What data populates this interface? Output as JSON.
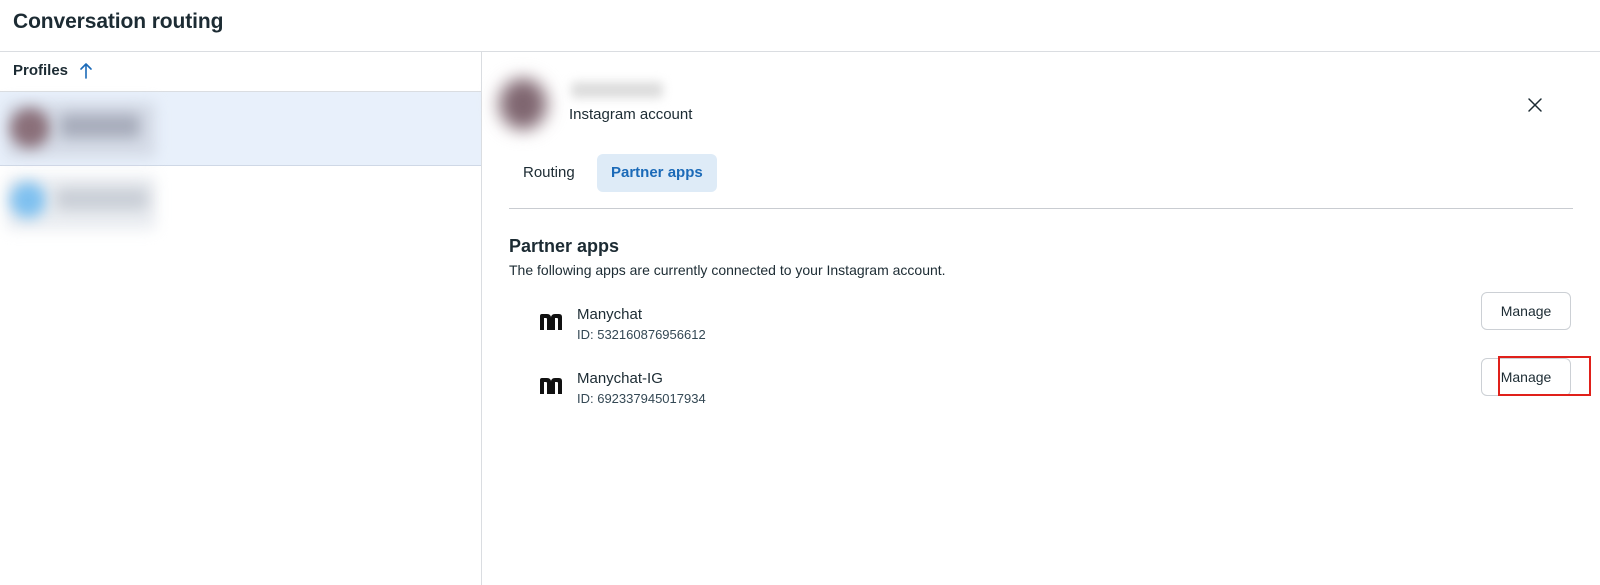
{
  "page": {
    "title": "Conversation routing"
  },
  "profiles": {
    "header_label": "Profiles",
    "sort_icon": "arrow-up-icon",
    "rows": [
      {
        "selected": true
      },
      {
        "selected": false
      }
    ]
  },
  "detail": {
    "account_type": "Instagram account",
    "close_icon": "close-icon",
    "tabs": [
      {
        "label": "Routing",
        "active": false
      },
      {
        "label": "Partner apps",
        "active": true
      }
    ],
    "section": {
      "title": "Partner apps",
      "description": "The following apps are currently connected to your Instagram account."
    },
    "apps": [
      {
        "name": "Manychat",
        "id": "ID: 532160876956612",
        "logo_icon": "manychat-logo-icon",
        "action_label": "Manage"
      },
      {
        "name": "Manychat-IG",
        "id": "ID: 692337945017934",
        "logo_icon": "manychat-logo-icon",
        "action_label": "Manage"
      }
    ]
  },
  "colors": {
    "accent": "#1b6ab8",
    "active_tab_bg": "#deebf7",
    "selected_row_bg": "#e8f0fb",
    "highlight": "#e0201a"
  }
}
